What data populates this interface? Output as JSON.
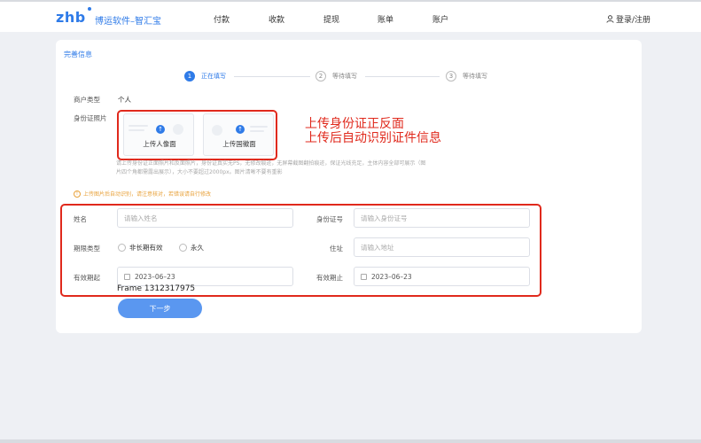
{
  "header": {
    "logo": "zhb",
    "brand": "博运软件–智汇宝",
    "nav": [
      "付款",
      "收款",
      "提现",
      "账单",
      "账户"
    ],
    "login": "登录/注册"
  },
  "card": {
    "title": "完善信息",
    "steps": [
      {
        "num": "1",
        "label": "正在填写"
      },
      {
        "num": "2",
        "label": "等待填写"
      },
      {
        "num": "3",
        "label": "等待填写"
      }
    ],
    "merchant_type_label": "商户类型",
    "merchant_type_value": "个人",
    "id_photo_label": "身份证照片",
    "upload_front": "上传人像面",
    "upload_back": "上传国徽面",
    "hint_line1": "请上传身份证正面照片和反面照片，身份证真实无PS，无修改痕迹，无屏幕截图翻拍痕迹，保证光线充足，主体内容全部可展示（图",
    "hint_line2": "片四个角都需露出展示），大小不要超过2000px。图片清晰不要有重影",
    "warning": "上传图片后自动识别，请注意核对，若错误请自行修改",
    "annotation_line1": "上传身份证正反面",
    "annotation_line2": "上传后自动识别证件信息",
    "form": {
      "name_label": "姓名",
      "name_placeholder": "请输入姓名",
      "id_label": "身份证号",
      "id_placeholder": "请输入身份证号",
      "period_label": "期限类型",
      "period_options": [
        "非长期有效",
        "永久"
      ],
      "address_label": "住址",
      "address_placeholder": "请输入地址",
      "start_label": "有效期起",
      "start_value": "2023–06–23",
      "end_label": "有效期止",
      "end_value": "2023–06–23"
    },
    "frame_label": "Frame 1312317975",
    "next_button": "下一步"
  },
  "colors": {
    "accent": "#2f7be8",
    "annotation": "#e0291c",
    "warning": "#e8a23b"
  }
}
